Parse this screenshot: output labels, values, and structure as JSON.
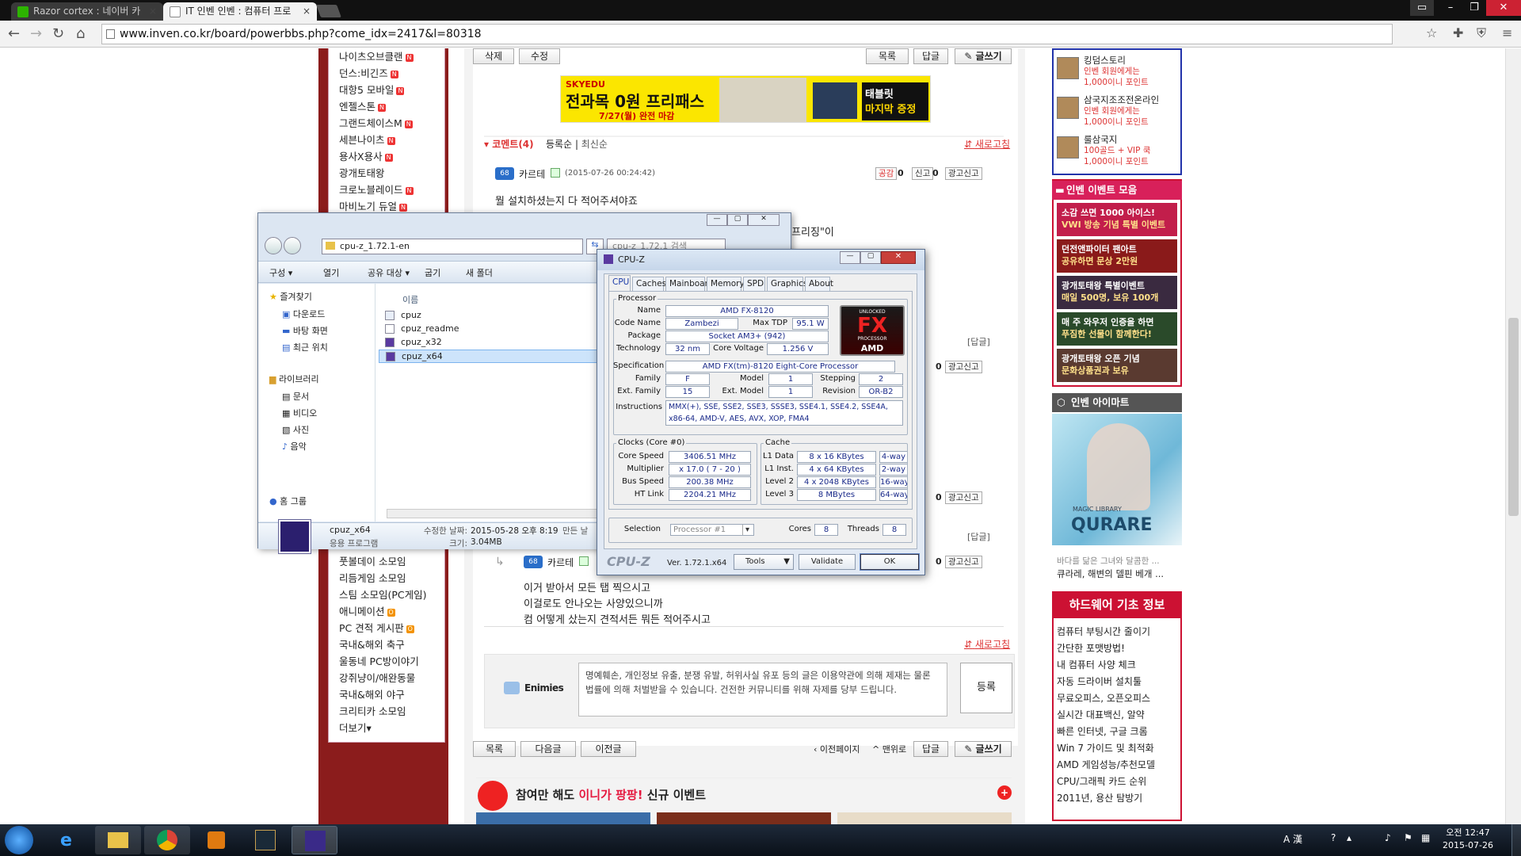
{
  "browser": {
    "tabs": [
      {
        "label": "Razor cortex : 네이버 카",
        "icon": "naver-icon"
      },
      {
        "label": "IT 인벤 인벤 : 컴퓨터 프로",
        "icon": "inven-icon"
      }
    ],
    "url": "www.inven.co.kr/board/powerbbs.php?come_idx=2417&l=80318"
  },
  "sidebar_left": {
    "items_top": [
      {
        "label": "나이츠오브클랜",
        "badge": "N"
      },
      {
        "label": "던스:비긴즈",
        "badge": "N"
      },
      {
        "label": "대항5 모바일",
        "badge": "N"
      },
      {
        "label": "엔젤스톤",
        "badge": "N"
      },
      {
        "label": "그랜드체이스M",
        "badge": "N"
      },
      {
        "label": "세븐나이츠",
        "badge": "N"
      },
      {
        "label": "용사X용사",
        "badge": "N"
      },
      {
        "label": "광개토태왕",
        "badge": ""
      },
      {
        "label": "크로노블레이드",
        "badge": "N"
      },
      {
        "label": "마비노기 듀얼",
        "badge": "N"
      }
    ],
    "items_bottom": [
      {
        "label": "풋볼데이 소모임",
        "badge": ""
      },
      {
        "label": "리듬게임 소모임",
        "badge": ""
      },
      {
        "label": "스팀 소모임(PC게임)",
        "badge": ""
      },
      {
        "label": "애니메이션",
        "badge": "O"
      },
      {
        "label": "PC 견적 게시판",
        "badge": "O"
      },
      {
        "label": "국내&해외 축구",
        "badge": ""
      },
      {
        "label": "울동네 PC방이야기",
        "badge": ""
      },
      {
        "label": "강쥐냥이/애완동물",
        "badge": ""
      },
      {
        "label": "국내&해외 야구",
        "badge": ""
      },
      {
        "label": "크리티카 소모임",
        "badge": ""
      },
      {
        "label": "더보기▾",
        "badge": ""
      }
    ]
  },
  "main": {
    "top_buttons": {
      "delete": "삭제",
      "edit": "수정",
      "list": "목록",
      "reply": "답글",
      "write": "✎ 글쓰기"
    },
    "ad": {
      "brand": "SKYEDU",
      "headline": "전과목 0원 프리패스",
      "sub": "7/27(월) 완전 마감",
      "right1": "태블릿",
      "right2": "마지막 증정"
    },
    "comments": {
      "title": "코멘트(4)",
      "sort1": "등록순",
      "sort2": "최신순",
      "refresh": "새로고침",
      "c1_user": "카르테",
      "c1_level": "68",
      "c1_date": "(2015-07-26 00:24:42)",
      "like": "공감",
      "like_count": "0",
      "report": "신고",
      "report_count": "0",
      "ad_report": "광고신고",
      "c1_text1": "뭘 설치하셨는지 다 적어주셔야죠",
      "c1_text_partial": "을 \"프리징\"이",
      "reply_tag": "[답글]",
      "c2_user": "카르테",
      "c2_level": "68",
      "c2_line1": "이거 받아서 모든 탭 찍으시고",
      "c2_line2": "이걸로도 안나오는 사양있으니까",
      "c2_line3": "컴 어떻게 샀는지 견적서든 뭐든 적어주시고",
      "refresh2": "새로고침",
      "user_name": "Enimies",
      "textarea_text": "명예훼손, 개인정보 유출, 분쟁 유발, 허위사실 유포 등의 글은 이용약관에 의해 제재는 물론 법률에 의해 처벌받을 수 있습니다. 건전한 커뮤니티를 위해 자제를 당부 드립니다.",
      "submit": "등록"
    },
    "bottom_buttons": {
      "list": "목록",
      "next": "다음글",
      "prev": "이전글",
      "prevpage": "‹ 이전페이지",
      "top": "^ 맨위로",
      "reply": "답글",
      "write": "✎ 글쓰기"
    },
    "event": {
      "prefix": "참여만 해도",
      "highlight": "이니가 팡팡!",
      "suffix": "신규 이벤트"
    }
  },
  "sidebar_right": {
    "games": [
      {
        "title": "킹덤스토리",
        "l1": "인벤 회원에게는",
        "l2": "1,000이니 포인트"
      },
      {
        "title": "삼국지조조전온라인",
        "l1": "인벤 회원에게는",
        "l2": "1,000이니 포인트"
      },
      {
        "title": "룰삼국지",
        "l1": "100골드 + VIP 쿡",
        "l2": "1,000이니 포인트"
      }
    ],
    "event_header": "인벤 이벤트 모음",
    "banners": [
      {
        "l1": "소감 쓰면 1000 아이스!",
        "l2": "VWI 방송 기념 특별 이벤트",
        "color": "#c21e4b"
      },
      {
        "l1": "던전앤파이터 팬아트",
        "l2": "공유하면 문상 2만원",
        "color": "#8a1a1a"
      },
      {
        "l1": "광개토태왕 특별이벤트",
        "l2": "매일 500명, 보유 100개",
        "color": "#3a2a40"
      },
      {
        "l1": "매 주 와우저 인증을 하면",
        "l2": "푸짐한 선물이 함께한다!",
        "color": "#2a4a2a"
      },
      {
        "l1": "광개토태왕 오픈 기념",
        "l2": "문화상품권과 보유",
        "color": "#5a3a30"
      }
    ],
    "imart_header": "인벤 아이마트",
    "imart_caption1": "바다를 닮은 그녀와 달콤한 ...",
    "imart_caption2": "큐라레, 해변의 델핀 베개 ...",
    "imart_brand": "QURARE",
    "imart_sub": "MAGIC LIBRARY",
    "hw_title": "하드웨어 기초 정보",
    "hw_items": [
      "컴퓨터 부팅시간 줄이기",
      "간단한 포맷방법!",
      "내 컴퓨터 사양 체크",
      "자동 드라이버 설치툴",
      "무료오피스, 오픈오피스",
      "실시간 대표백신, 알약",
      "빠른 인터넷, 구글 크롬",
      "Win 7 가이드 및 최적화",
      "AMD 게임성능/추천모델",
      "CPU/그래픽 카드 순위",
      "2011년, 용산 탐방기"
    ]
  },
  "explorer": {
    "path": "cpu-z_1.72.1-en",
    "search_placeholder": "cpu-z_1.72.1 검색",
    "toolbar": [
      "구성 ▾",
      "열기",
      "공유 대상 ▾",
      "굽기",
      "새 폴더"
    ],
    "nav": {
      "favorites": "즐겨찾기",
      "fav_items": [
        "다운로드",
        "바탕 화면",
        "최근 위치"
      ],
      "libraries": "라이브러리",
      "lib_items": [
        "문서",
        "비디오",
        "사진",
        "음악"
      ],
      "homegroup": "홈 그룹"
    },
    "column": "이름",
    "files": [
      "cpuz",
      "cpuz_readme",
      "cpuz_x32",
      "cpuz_x64"
    ],
    "details": {
      "name": "cpuz_x64",
      "type": "응용 프로그램",
      "modified_label": "수정한 날짜:",
      "modified": "2015-05-28 오후 8:19",
      "created_label": "만든 날",
      "size_label": "크기:",
      "size": "3.04MB"
    }
  },
  "cpuz": {
    "title": "CPU-Z",
    "tabs": [
      "CPU",
      "Caches",
      "Mainboard",
      "Memory",
      "SPD",
      "Graphics",
      "About"
    ],
    "processor_group": "Processor",
    "name_l": "Name",
    "name": "AMD FX-8120",
    "code_l": "Code Name",
    "code": "Zambezi",
    "tdp_l": "Max TDP",
    "tdp": "95.1 W",
    "pkg_l": "Package",
    "pkg": "Socket AM3+ (942)",
    "tech_l": "Technology",
    "tech": "32 nm",
    "volt_l": "Core Voltage",
    "volt": "1.256 V",
    "spec_l": "Specification",
    "spec": "AMD FX(tm)-8120 Eight-Core Processor",
    "fam_l": "Family",
    "fam": "F",
    "model_l": "Model",
    "model": "1",
    "step_l": "Stepping",
    "step": "2",
    "efam_l": "Ext. Family",
    "efam": "15",
    "emodel_l": "Ext. Model",
    "emodel": "1",
    "rev_l": "Revision",
    "rev": "OR-B2",
    "instr_l": "Instructions",
    "instr1": "MMX(+), SSE, SSE2, SSE3, SSSE3, SSE4.1, SSE4.2, SSE4A,",
    "instr2": "x86-64, AMD-V, AES, AVX, XOP, FMA4",
    "clocks_group": "Clocks (Core #0)",
    "cspeed_l": "Core Speed",
    "cspeed": "3406.51 MHz",
    "mult_l": "Multiplier",
    "mult": "x 17.0 ( 7 - 20 )",
    "bus_l": "Bus Speed",
    "bus": "200.38 MHz",
    "ht_l": "HT Link",
    "ht": "2204.21 MHz",
    "cache_group": "Cache",
    "l1d_l": "L1 Data",
    "l1d": "8 x 16 KBytes",
    "l1d_w": "4-way",
    "l1i_l": "L1 Inst.",
    "l1i": "4 x 64 KBytes",
    "l1i_w": "2-way",
    "l2_l": "Level 2",
    "l2": "4 x 2048 KBytes",
    "l2_w": "16-way",
    "l3_l": "Level 3",
    "l3": "8 MBytes",
    "l3_w": "64-way",
    "sel_l": "Selection",
    "sel": "Processor #1",
    "cores_l": "Cores",
    "cores": "8",
    "threads_l": "Threads",
    "threads": "8",
    "brand": "CPU-Z",
    "version": "Ver. 1.72.1.x64",
    "tools": "Tools",
    "validate": "Validate",
    "ok": "OK",
    "logo_top": "UNLOCKED",
    "logo_mid": "FX",
    "logo_sub": "PROCESSOR",
    "logo_bottom": "AMD"
  },
  "taskbar": {
    "time": "오전 12:47",
    "date": "2015-07-26",
    "ime": "A 漢"
  }
}
